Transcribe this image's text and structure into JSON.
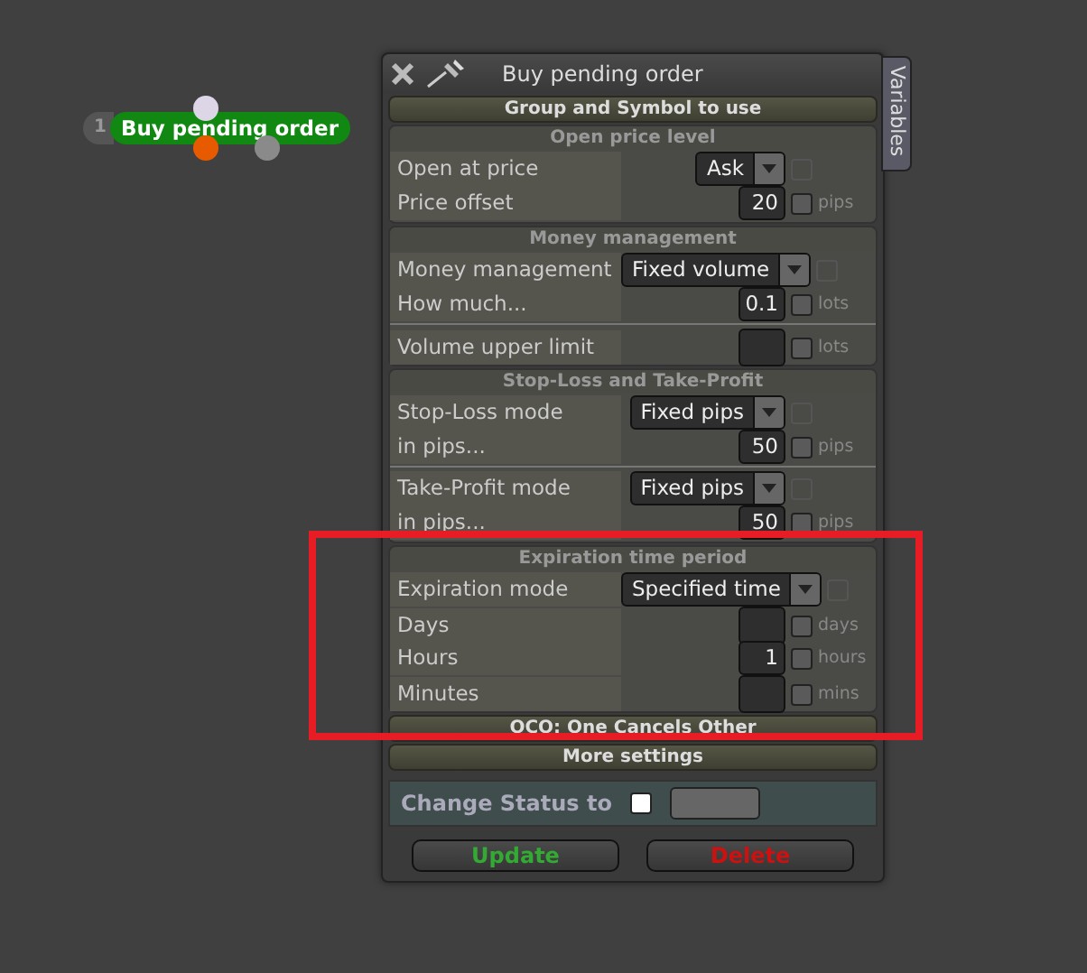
{
  "node": {
    "index": "1",
    "label": "Buy pending order"
  },
  "panel": {
    "title": "Buy pending order",
    "side_tab": "Variables",
    "top_header": "Group and Symbol to use",
    "sections": [
      {
        "header": "Open price level",
        "groups": [
          [
            {
              "kind": "select",
              "label": "Open at price",
              "value": "Ask",
              "checked": false
            },
            {
              "kind": "number",
              "label": "Price offset",
              "value": "20",
              "unit": "pips",
              "checked": false
            }
          ]
        ]
      },
      {
        "header": "Money management",
        "groups": [
          [
            {
              "kind": "select",
              "label": "Money management",
              "value": "Fixed volume",
              "checked": false
            },
            {
              "kind": "number",
              "label": "How much...",
              "value": "0.1",
              "unit": "lots",
              "checked": false
            }
          ],
          [
            {
              "kind": "number",
              "label": "Volume upper limit",
              "unit": "lots",
              "checked": false
            }
          ]
        ]
      },
      {
        "header": "Stop-Loss and Take-Profit",
        "groups": [
          [
            {
              "kind": "select",
              "label": "Stop-Loss mode",
              "value": "Fixed pips",
              "checked": false
            },
            {
              "kind": "number",
              "label": "in pips...",
              "value": "50",
              "unit": "pips",
              "checked": false
            }
          ],
          [
            {
              "kind": "select",
              "label": "Take-Profit mode",
              "value": "Fixed pips",
              "checked": false
            },
            {
              "kind": "number",
              "label": "in pips...",
              "value": "50",
              "unit": "pips",
              "checked": false
            }
          ]
        ]
      },
      {
        "header": "Expiration time period",
        "groups": [
          [
            {
              "kind": "select",
              "label": "Expiration mode",
              "value": "Specified time",
              "checked": false
            },
            {
              "kind": "number",
              "label": "Days",
              "unit": "days",
              "checked": false
            },
            {
              "kind": "number",
              "label": "Hours",
              "value": "1",
              "unit": "hours",
              "checked": false
            },
            {
              "kind": "number",
              "label": "Minutes",
              "unit": "mins",
              "checked": false
            }
          ]
        ]
      }
    ],
    "collapsed_headers": [
      "OCO: One Cancels Other",
      "More settings"
    ],
    "status": {
      "label": "Change Status to",
      "checked": false
    },
    "buttons": [
      {
        "label": "Update",
        "kind": "update"
      },
      {
        "label": "Delete",
        "kind": "delete"
      }
    ]
  }
}
